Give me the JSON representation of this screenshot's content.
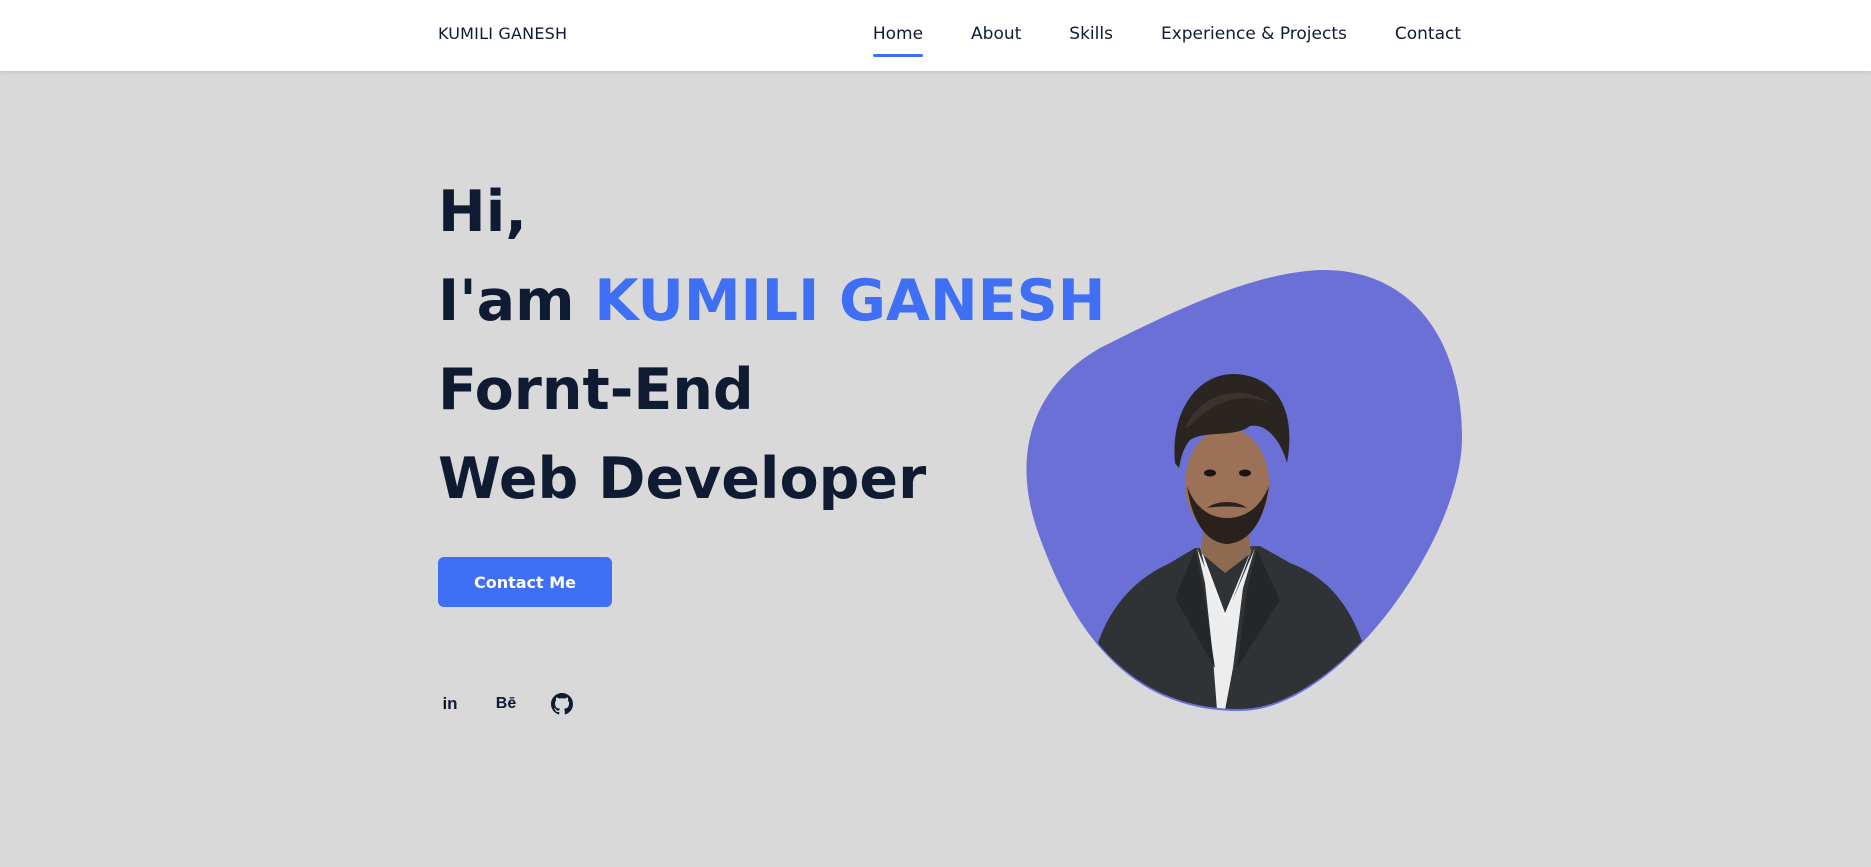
{
  "header": {
    "logo": "KUMILI GANESH",
    "nav": [
      {
        "label": "Home",
        "active": true
      },
      {
        "label": "About"
      },
      {
        "label": "Skills"
      },
      {
        "label": "Experience & Projects"
      },
      {
        "label": "Contact"
      }
    ]
  },
  "hero": {
    "greeting": "Hi,",
    "intro_prefix": "I'am ",
    "name": "KUMILI GANESH",
    "role_line1": "Fornt-End",
    "role_line2": "Web Developer",
    "cta_label": "Contact Me"
  },
  "socials": [
    {
      "icon": "linkedin-icon",
      "text": "in"
    },
    {
      "icon": "behance-icon",
      "text": "Bē"
    },
    {
      "icon": "github-icon"
    }
  ],
  "colors": {
    "accent": "#3e6ff4",
    "background": "#d9d9d9",
    "text": "#0f1a33",
    "blob": "#6b70d6"
  }
}
